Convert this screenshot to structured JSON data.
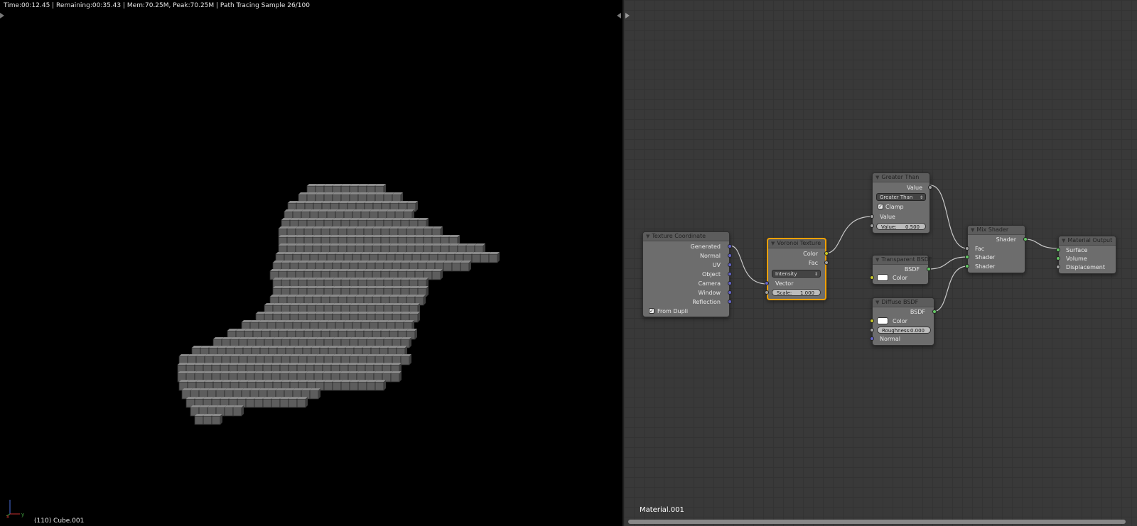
{
  "viewport": {
    "render_status": "Time:00:12.45 | Remaining:00:35.43 | Mem:70.25M, Peak:70.25M | Path Tracing Sample 26/100",
    "object_label": "(110) Cube.001",
    "axis_x": "x",
    "axis_y": "y"
  },
  "node_editor": {
    "material_name": "Material.001",
    "nodes": {
      "texture_coordinate": {
        "title": "Texture Coordinate",
        "outputs": [
          "Generated",
          "Normal",
          "UV",
          "Object",
          "Camera",
          "Window",
          "Reflection"
        ],
        "from_dupli": "From Dupli"
      },
      "voronoi": {
        "title": "Voronoi Texture",
        "out_color": "Color",
        "out_fac": "Fac",
        "coloring": "Intensity",
        "in_vector": "Vector",
        "scale_label": "Scale:",
        "scale_value": "1.000"
      },
      "greater_than": {
        "title": "Greater Than",
        "out_value": "Value",
        "operation": "Greater Than",
        "clamp": "Clamp",
        "in_value": "Value",
        "value_label": "Value:",
        "value_value": "0.500"
      },
      "transparent": {
        "title": "Transparent BSDF",
        "out_bsdf": "BSDF",
        "in_color": "Color"
      },
      "diffuse": {
        "title": "Diffuse BSDF",
        "out_bsdf": "BSDF",
        "in_color": "Color",
        "roughness_label": "Roughness:",
        "roughness_value": "0.000",
        "in_normal": "Normal"
      },
      "mix_shader": {
        "title": "Mix Shader",
        "out_shader": "Shader",
        "in_fac": "Fac",
        "in_shader1": "Shader",
        "in_shader2": "Shader"
      },
      "material_output": {
        "title": "Material Output",
        "in_surface": "Surface",
        "in_volume": "Volume",
        "in_displacement": "Displacement"
      }
    }
  },
  "colors": {
    "socket_vector": "#6363c7",
    "socket_float": "#a1a1a1",
    "socket_color": "#c7c729",
    "socket_shader": "#63c763",
    "active_node_border": "#f0a000"
  }
}
